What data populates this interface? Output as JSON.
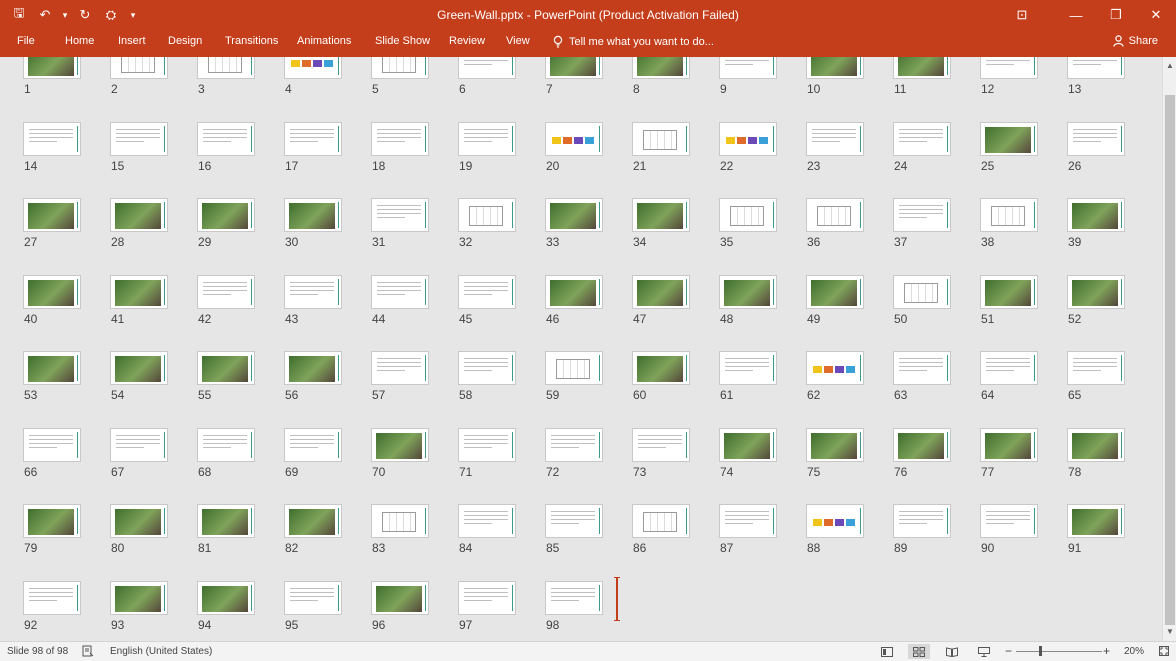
{
  "window": {
    "title": "Green-Wall.pptx - PowerPoint (Product Activation Failed)",
    "controls": [
      "⊡",
      "—",
      "❐",
      "✕"
    ]
  },
  "qat": {
    "save": "🖫",
    "undo": "↶",
    "undo_drop": "▾",
    "redo": "↻",
    "slideshow": "⛭",
    "customize": "▾"
  },
  "ribbon": {
    "tabs": [
      "File",
      "Home",
      "Insert",
      "Design",
      "Transitions",
      "Animations",
      "Slide Show",
      "Review",
      "View"
    ],
    "tell_me": "Tell me what you want to do...",
    "share": "Share"
  },
  "slides": {
    "total": 98,
    "selected": 98,
    "numbers": [
      "1",
      "2",
      "3",
      "4",
      "5",
      "6",
      "7",
      "8",
      "9",
      "10",
      "11",
      "12",
      "13",
      "14",
      "15",
      "16",
      "17",
      "18",
      "19",
      "20",
      "21",
      "22",
      "23",
      "24",
      "25",
      "26",
      "27",
      "28",
      "29",
      "30",
      "31",
      "32",
      "33",
      "34",
      "35",
      "36",
      "37",
      "38",
      "39",
      "40",
      "41",
      "42",
      "43",
      "44",
      "45",
      "46",
      "47",
      "48",
      "49",
      "50",
      "51",
      "52",
      "53",
      "54",
      "55",
      "56",
      "57",
      "58",
      "59",
      "60",
      "61",
      "62",
      "63",
      "64",
      "65",
      "66",
      "67",
      "68",
      "69",
      "70",
      "71",
      "72",
      "73",
      "74",
      "75",
      "76",
      "77",
      "78",
      "79",
      "80",
      "81",
      "82",
      "83",
      "84",
      "85",
      "86",
      "87",
      "88",
      "89",
      "90",
      "91",
      "92",
      "93",
      "94",
      "95",
      "96",
      "97",
      "98"
    ],
    "kinds": [
      "photo",
      "diagram",
      "diagram",
      "chart",
      "diagram",
      "text",
      "photo",
      "photo",
      "text",
      "photo",
      "photo",
      "text",
      "text",
      "text",
      "text",
      "text",
      "text",
      "text",
      "text",
      "chart",
      "diagram",
      "chart",
      "text",
      "text",
      "photo",
      "text",
      "photo",
      "photo",
      "photo",
      "photo",
      "text",
      "diagram",
      "photo",
      "photo",
      "diagram",
      "diagram",
      "text",
      "diagram",
      "photo",
      "photo",
      "photo",
      "text",
      "text",
      "text",
      "text",
      "photo",
      "photo",
      "photo",
      "photo",
      "diagram",
      "photo",
      "photo",
      "photo",
      "photo",
      "photo",
      "photo",
      "text",
      "text",
      "diagram",
      "photo",
      "text",
      "chart",
      "text",
      "text",
      "text",
      "text",
      "text",
      "text",
      "text",
      "photo",
      "text",
      "text",
      "text",
      "photo",
      "photo",
      "photo",
      "photo",
      "photo",
      "photo",
      "photo",
      "photo",
      "photo",
      "diagram",
      "text",
      "text",
      "diagram",
      "text",
      "chart",
      "text",
      "text",
      "photo",
      "text",
      "photo",
      "photo",
      "text",
      "photo",
      "text",
      "text"
    ]
  },
  "statusbar": {
    "slide_info": "Slide 98 of 98",
    "language": "English (United States)",
    "zoom_minus": "−",
    "zoom_plus": "+",
    "zoom": "20%"
  },
  "colors": {
    "accent": "#c43e1c",
    "background": "#e6e6e6",
    "photo_green": "#3f6e2e",
    "teal_line": "#3c9a8c"
  }
}
